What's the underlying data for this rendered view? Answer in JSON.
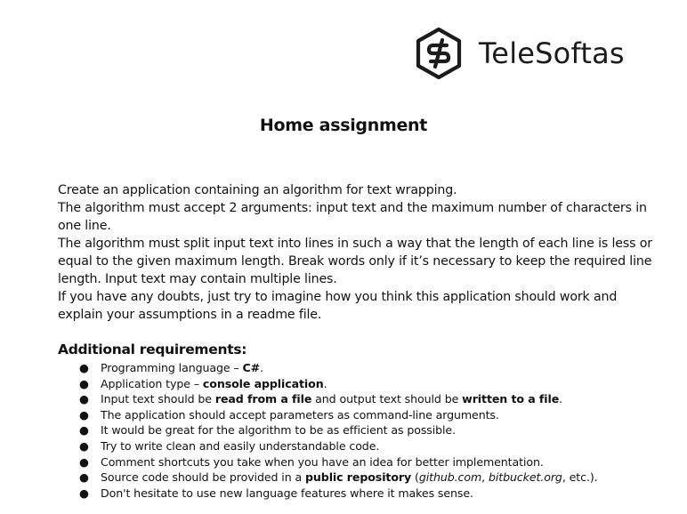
{
  "logo": {
    "text": "TeleSoftas",
    "icon": "telesoftas-hexagon-s-icon"
  },
  "title": "Home assignment",
  "intro": [
    "Create an application containing an algorithm for text wrapping.",
    "The algorithm must accept 2 arguments: input text and the maximum number of characters in one line.",
    "The algorithm must split input text into lines in such a way that the length of each line is less or equal to the given maximum length. Break words only if it’s necessary to keep the required line length. Input text may contain multiple lines.",
    "If you have any doubts, just try to imagine how you think this application should work and explain your assumptions in a readme file."
  ],
  "requirements": {
    "heading": "Additional requirements:",
    "bullet": "●",
    "items": [
      {
        "t1": "Programming language – ",
        "b1": "C#",
        "t2": "."
      },
      {
        "t1": "Application type – ",
        "b1": "console application",
        "t2": "."
      },
      {
        "t1": "Input text should be ",
        "b1": "read from a file",
        "t2": " and output text should be ",
        "b2": "written to a file",
        "t3": "."
      },
      {
        "t1": "The application should accept parameters as command-line arguments."
      },
      {
        "t1": "It would be great for the algorithm to be as efficient as possible."
      },
      {
        "t1": "Try to write clean and easily understandable code."
      },
      {
        "t1": "Comment shortcuts you take when you have an idea for better implementation."
      },
      {
        "t1": "Source code should be provided in a ",
        "b1": "public repository",
        "t2": " (",
        "i1": "github.com",
        "t3": ", ",
        "i2": "bitbucket.org",
        "t4": ", etc.)."
      },
      {
        "t1": "Don't hesitate to use new language features where it makes sense."
      }
    ]
  }
}
